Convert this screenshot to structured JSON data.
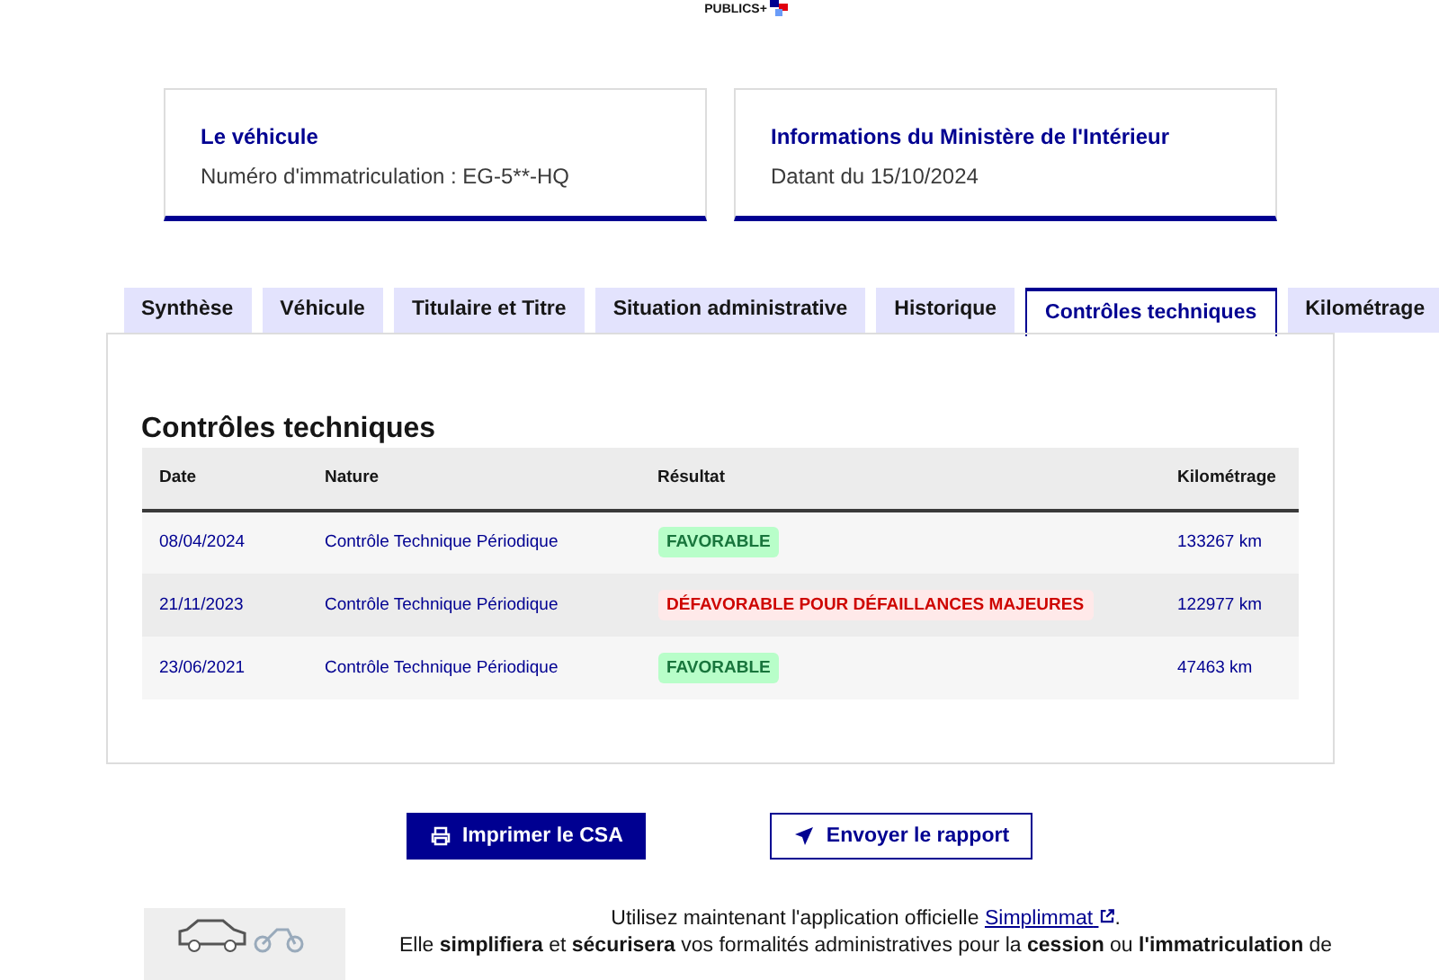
{
  "header": {
    "logo_text": "PUBLICS+"
  },
  "cards": [
    {
      "title": "Le véhicule",
      "text": "Numéro d'immatriculation : EG-5**-HQ"
    },
    {
      "title": "Informations du Ministère de l'Intérieur",
      "text": "Datant du 15/10/2024"
    }
  ],
  "tabs": [
    {
      "label": "Synthèse",
      "selected": false
    },
    {
      "label": "Véhicule",
      "selected": false
    },
    {
      "label": "Titulaire et Titre",
      "selected": false
    },
    {
      "label": "Situation administrative",
      "selected": false
    },
    {
      "label": "Historique",
      "selected": false
    },
    {
      "label": "Contrôles techniques",
      "selected": true
    },
    {
      "label": "Kilométrage",
      "selected": false
    }
  ],
  "section_title": "Contrôles techniques",
  "table": {
    "columns": [
      "Date",
      "Nature",
      "Résultat",
      "Kilométrage"
    ],
    "rows": [
      {
        "date": "08/04/2024",
        "nature": "Contrôle Technique Périodique",
        "result": {
          "label": "FAVORABLE",
          "kind": "success"
        },
        "mileage": "133267 km"
      },
      {
        "date": "21/11/2023",
        "nature": "Contrôle Technique Périodique",
        "result": {
          "label": "DÉFAVORABLE POUR DÉFAILLANCES MAJEURES",
          "kind": "error"
        },
        "mileage": "122977 km"
      },
      {
        "date": "23/06/2021",
        "nature": "Contrôle Technique Périodique",
        "result": {
          "label": "FAVORABLE",
          "kind": "success"
        },
        "mileage": "47463 km"
      }
    ]
  },
  "buttons": [
    {
      "label": "Imprimer le CSA",
      "kind": "primary"
    },
    {
      "label": "Envoyer le rapport",
      "kind": "secondary"
    }
  ],
  "promo": {
    "line_1_before": "Utilisez maintenant l'application officielle",
    "link": "Simplimmat",
    "line_1_after": ".",
    "line_2": "Elle **simplifiera** et **sécurisera** vos formalités administratives pour la **cession** ou **l'immatriculation** de"
  }
}
